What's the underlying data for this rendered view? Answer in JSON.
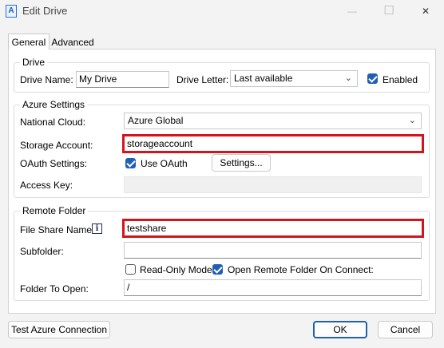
{
  "window": {
    "title": "Edit Drive",
    "app_icon_letter": "A",
    "minimize_glyph": "—",
    "maximize_glyph": "☐",
    "close_glyph": "✕"
  },
  "tabs": [
    {
      "label": "General",
      "selected": true
    },
    {
      "label": "Advanced",
      "selected": false
    }
  ],
  "drive": {
    "group_title": "Drive",
    "name_label": "Drive Name:",
    "name_value": "My Drive",
    "letter_label": "Drive Letter:",
    "letter_value": "Last available",
    "enabled_label": "Enabled",
    "enabled_checked": true
  },
  "azure": {
    "group_title": "Azure Settings",
    "cloud_label": "National Cloud:",
    "cloud_value": "Azure Global",
    "storage_label": "Storage Account:",
    "storage_value": "storageaccount",
    "oauth_label": "OAuth Settings:",
    "use_oauth_label": "Use OAuth",
    "use_oauth_checked": true,
    "settings_button": "Settings...",
    "access_key_label": "Access Key:",
    "access_key_value": ""
  },
  "remote": {
    "group_title": "Remote Folder",
    "share_label": "File Share Name:",
    "info_glyph": "i",
    "share_value": "testshare",
    "subfolder_label": "Subfolder:",
    "subfolder_value": "",
    "readonly_label": "Read-Only Mode",
    "readonly_checked": false,
    "open_on_connect_label": "Open Remote Folder On Connect:",
    "open_on_connect_checked": true,
    "folder_to_open_label": "Folder To Open:",
    "folder_to_open_value": "/"
  },
  "footer": {
    "test_button": "Test Azure Connection",
    "ok_button": "OK",
    "cancel_button": "Cancel"
  },
  "colors": {
    "highlight": "#d4141c",
    "checkbox_accent": "#1f5fb5"
  }
}
